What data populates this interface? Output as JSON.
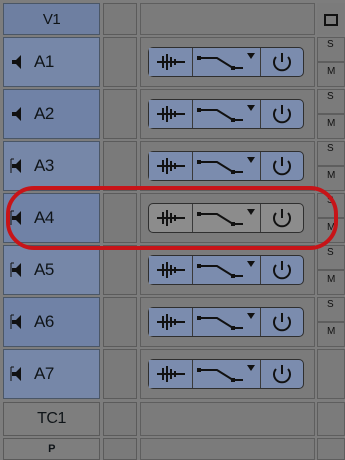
{
  "tracks": {
    "video": {
      "label": "V1"
    },
    "audio": [
      {
        "label": "A1",
        "solo": "S",
        "mute": "M"
      },
      {
        "label": "A2",
        "solo": "S",
        "mute": "M"
      },
      {
        "label": "A3",
        "solo": "S",
        "mute": "M"
      },
      {
        "label": "A4",
        "solo": "S",
        "mute": "M"
      },
      {
        "label": "A5",
        "solo": "S",
        "mute": "M"
      },
      {
        "label": "A6",
        "solo": "S",
        "mute": "M"
      },
      {
        "label": "A7"
      }
    ],
    "timecode": {
      "label": "TC1"
    },
    "bottom": {
      "label": "P"
    }
  },
  "colors": {
    "highlight": "#c71418",
    "track_blue": "#7687a8"
  },
  "icons": {
    "speaker": "speaker-icon",
    "waveform": "audio-waveform-icon",
    "automation": "volume-automation-icon",
    "power": "power-icon"
  }
}
